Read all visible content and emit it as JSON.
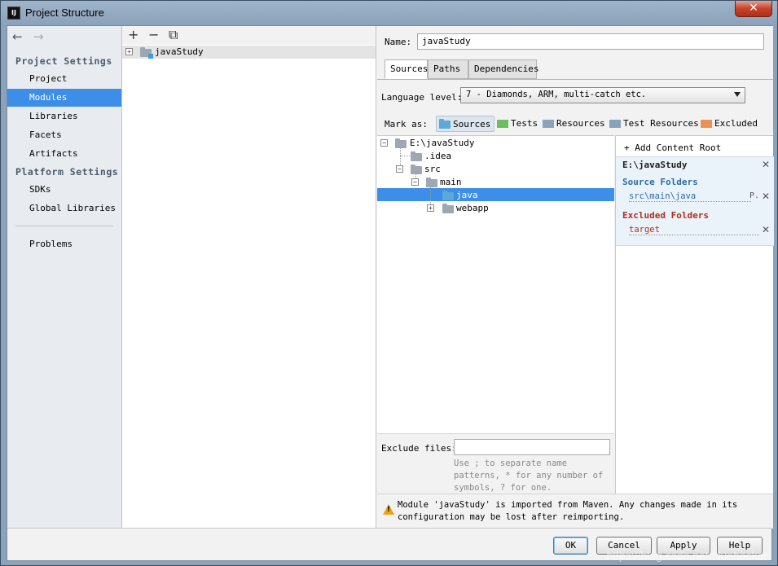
{
  "window": {
    "title": "Project Structure",
    "app_icon": "IJ",
    "close_symbol": "✕"
  },
  "nav": {
    "back_arrow": "←",
    "forward_arrow": "→",
    "section_project": "Project Settings",
    "section_platform": "Platform Settings",
    "items": [
      "Project",
      "Modules",
      "Libraries",
      "Facets",
      "Artifacts",
      "SDKs",
      "Global Libraries",
      "Problems"
    ],
    "selected": "Modules"
  },
  "module_list": {
    "toolbar": [
      "+",
      "−",
      "⧉"
    ],
    "modules": [
      "javaStudy"
    ]
  },
  "module": {
    "name_label": "Name:",
    "name_value": "javaStudy",
    "tabs": [
      "Sources",
      "Paths",
      "Dependencies"
    ],
    "active_tab": "Sources",
    "language_level_label": "Language level:",
    "language_level_value": "7 - Diamonds, ARM, multi-catch etc.",
    "mark_as_label": "Mark as:",
    "mark_as": [
      "Sources",
      "Tests",
      "Resources",
      "Test Resources",
      "Excluded"
    ],
    "mark_colors": [
      "#5aa9d8",
      "#6cbf5e",
      "#8aa3b8",
      "#8aa3b8",
      "#e8925a"
    ],
    "tree": [
      "E:\\javaStudy",
      ".idea",
      "src",
      "main",
      "java",
      "webapp"
    ],
    "add_content_root": "Add Content Root",
    "content_root": "E:\\javaStudy",
    "source_folders_title": "Source Folders",
    "source_folder": "src\\main\\java",
    "source_folder_suffix": "P.",
    "excluded_folders_title": "Excluded Folders",
    "excluded_folder": "target",
    "exclude_files_label": "Exclude files:",
    "exclude_files_value": "",
    "exclude_hint": "Use ; to separate name patterns, * for any number of symbols, ? for one.",
    "warning": "Module 'javaStudy' is imported from Maven. Any changes made in its configuration may be lost after reimporting."
  },
  "buttons": {
    "ok": "OK",
    "cancel": "Cancel",
    "apply": "Apply",
    "help": "Help"
  },
  "watermark": "https://blog.csdn.net/bluehacker"
}
